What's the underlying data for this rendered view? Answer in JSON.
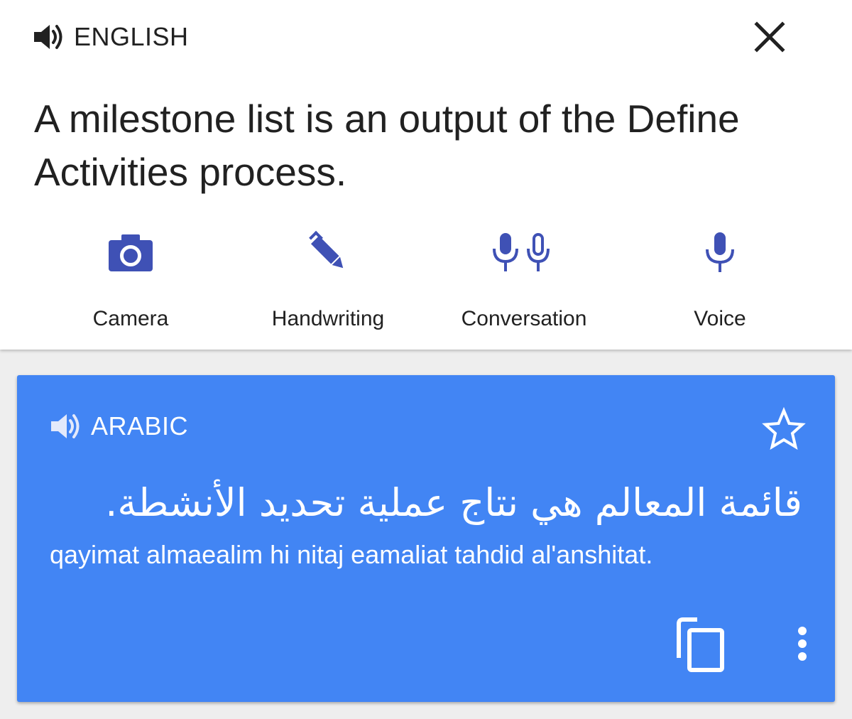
{
  "source": {
    "language": "ENGLISH",
    "text": "A milestone list is an output of the Define Activities process."
  },
  "tools": [
    {
      "label": "Camera",
      "icon": "camera-icon"
    },
    {
      "label": "Handwriting",
      "icon": "pen-icon"
    },
    {
      "label": "Conversation",
      "icon": "dual-microphone-icon"
    },
    {
      "label": "Voice",
      "icon": "microphone-icon"
    }
  ],
  "result": {
    "language": "ARABIC",
    "text": "قائمة المعالم هي نتاج عملية تحديد الأنشطة.",
    "transliteration": "qayimat almaealim hi nitaj eamaliat tahdid al'anshitat."
  },
  "colors": {
    "accent": "#3f51b5",
    "card": "#4285f4",
    "text": "#212121",
    "background": "#eeeeee"
  }
}
